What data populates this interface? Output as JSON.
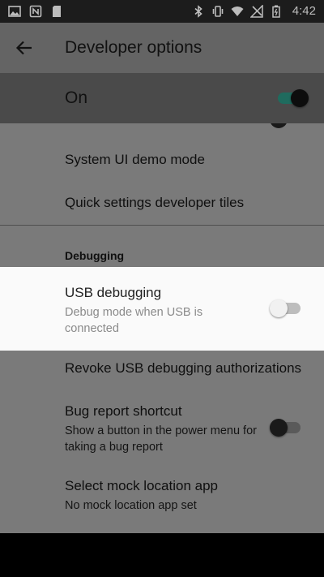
{
  "status_bar": {
    "time": "4:42",
    "left_icons": [
      "image-icon",
      "nfc-icon",
      "sd-card-icon"
    ],
    "right_icons": [
      "bluetooth-icon",
      "vibrate-icon",
      "wifi-icon",
      "no-signal-icon",
      "battery-icon"
    ]
  },
  "app_bar": {
    "title": "Developer options",
    "back_icon": "arrow-back-icon"
  },
  "master_switch": {
    "label": "On",
    "checked": true
  },
  "items": [
    {
      "title": "System UI demo mode"
    },
    {
      "title": "Quick settings developer tiles"
    }
  ],
  "section": {
    "title": "Debugging"
  },
  "usb_debugging": {
    "title": "USB debugging",
    "summary": "Debug mode when USB is connected",
    "checked": false
  },
  "revoke": {
    "title": "Revoke USB debugging authorizations"
  },
  "bug_report": {
    "title": "Bug report shortcut",
    "summary": "Show a button in the power menu for taking a bug report",
    "checked": false
  },
  "mock_location": {
    "title": "Select mock location app",
    "summary": "No mock location app set"
  },
  "colors": {
    "app_bar": "#646464",
    "master_bar": "#4a4a4a",
    "dimmed_list": "#7a7a7a",
    "highlight_row": "#fafafa",
    "accent": "#1f6b5e"
  }
}
